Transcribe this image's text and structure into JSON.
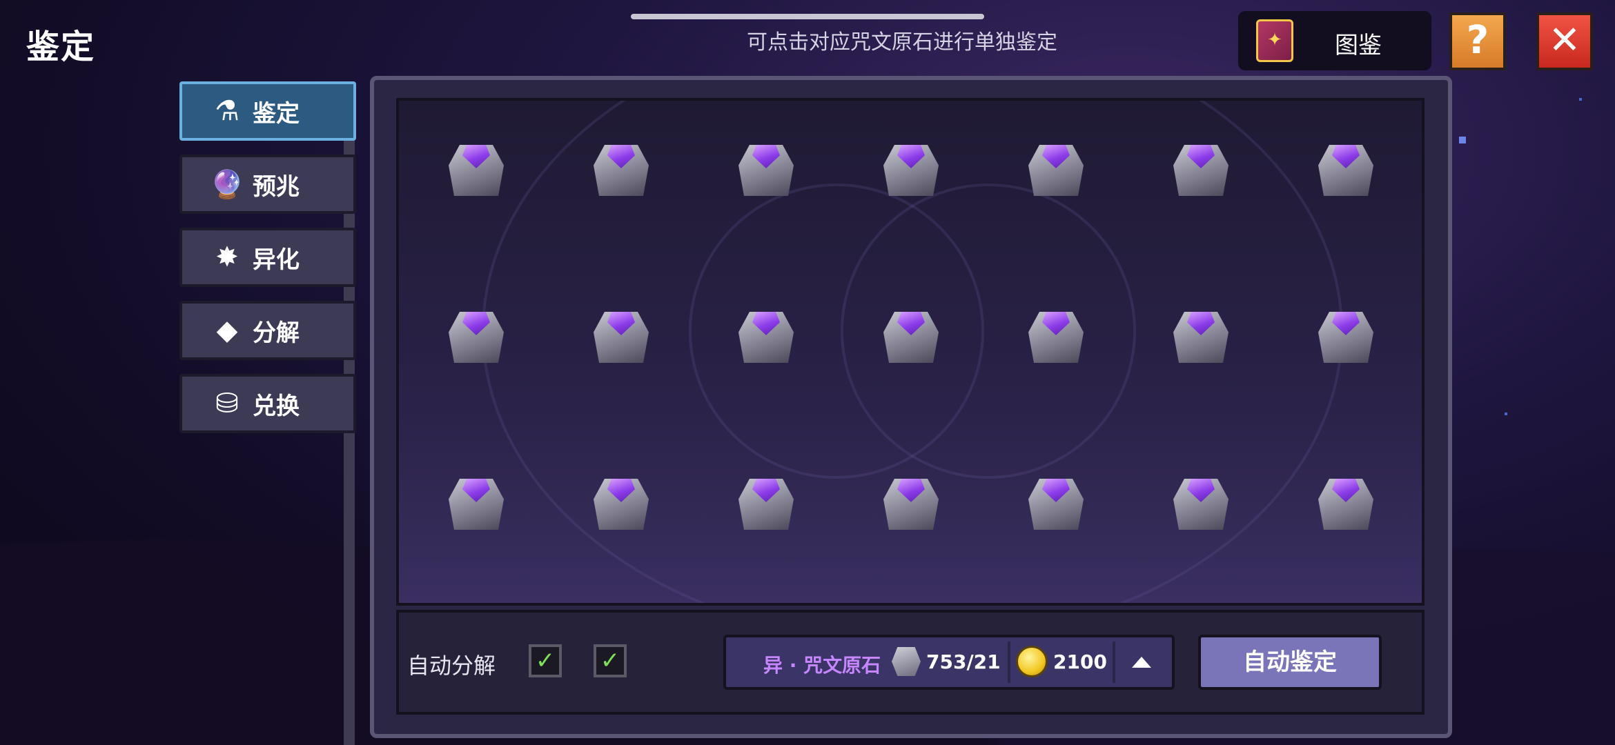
{
  "header": {
    "title": "鉴定",
    "hint": "可点击对应咒文原石进行单独鉴定",
    "codex_label": "图鉴",
    "codex_icon": "codex-book-icon",
    "help_icon": "question-icon",
    "close_icon": "close-icon"
  },
  "tabs": [
    {
      "label": "鉴定",
      "icon": "appraisal-icon",
      "active": true
    },
    {
      "label": "预兆",
      "icon": "crystal-ball-icon",
      "active": false
    },
    {
      "label": "异化",
      "icon": "mutation-icon",
      "active": false
    },
    {
      "label": "分解",
      "icon": "decompose-icon",
      "active": false
    },
    {
      "label": "兑换",
      "icon": "exchange-icon",
      "active": false
    }
  ],
  "grid": {
    "rows": 3,
    "cols": 7,
    "item_icon": "rune-ore-stone-icon"
  },
  "footer": {
    "auto_decompose_label": "自动分解",
    "checkbox_1_checked": true,
    "checkbox_2_checked": true,
    "resource_name": "异 · 咒文原石",
    "resource_count": "753/21",
    "gold_count": "2100",
    "expand_icon": "triangle-up-icon",
    "auto_appraise_label": "自动鉴定"
  },
  "colors": {
    "accent_purple": "#c686ff",
    "button_purple": "#7a74b8",
    "active_tab": "#2c5a80",
    "help_orange": "#e8923a",
    "close_red": "#e03a30"
  }
}
